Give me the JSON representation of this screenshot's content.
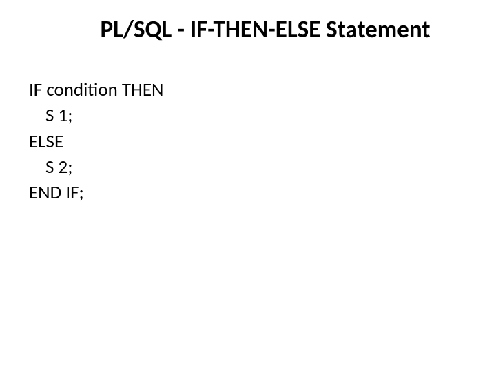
{
  "title": "PL/SQL - IF-THEN-ELSE Statement",
  "code": {
    "line1": "IF condition THEN",
    "line2": "S 1;",
    "line3": "ELSE",
    "line4": "S 2;",
    "line5": "END IF;"
  }
}
